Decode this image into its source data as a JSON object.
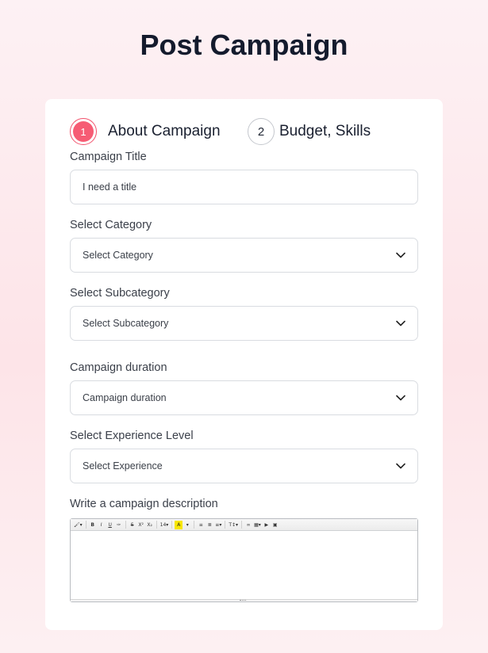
{
  "page": {
    "title": "Post Campaign"
  },
  "stepper": {
    "steps": [
      {
        "number": "1",
        "label": "About Campaign",
        "active": true
      },
      {
        "number": "2",
        "label": "Budget, Skills",
        "active": false
      }
    ]
  },
  "form": {
    "title": {
      "label": "Campaign Title",
      "value": "I need a title"
    },
    "category": {
      "label": "Select Category",
      "selected": "Select Category"
    },
    "subcategory": {
      "label": "Select Subcategory",
      "selected": "Select Subcategory"
    },
    "duration": {
      "label": "Campaign duration",
      "selected": "Campaign duration"
    },
    "experience": {
      "label": "Select Experience Level",
      "selected": "Select Experience"
    },
    "description": {
      "label": "Write a campaign description",
      "toolbar": [
        "brush",
        "bold",
        "italic",
        "underline",
        "clear-format",
        "strikethrough",
        "superscript",
        "subscript",
        "font-size",
        "font-color",
        "unordered-list",
        "ordered-list",
        "align",
        "line-height",
        "link",
        "table",
        "video",
        "image"
      ],
      "toolbar_text": {
        "font_size": "14"
      }
    }
  },
  "colors": {
    "accent": "#f65c74",
    "title": "#141b2d",
    "border": "#d9dce1"
  }
}
